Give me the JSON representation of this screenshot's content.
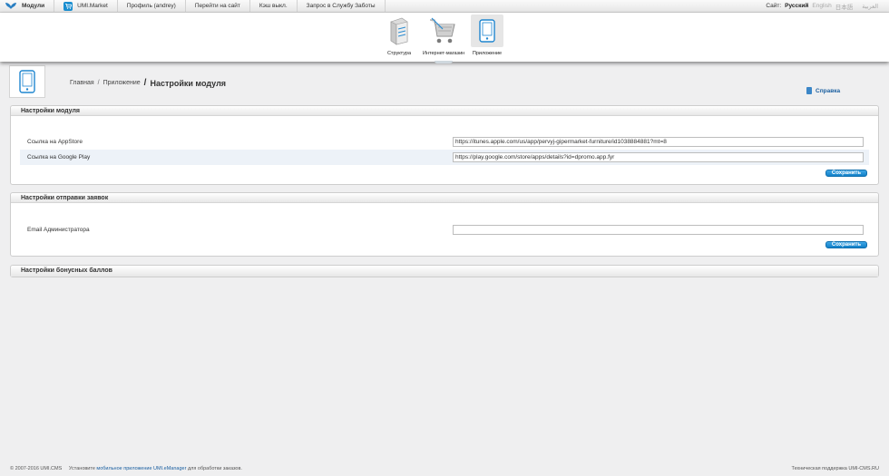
{
  "topbar": {
    "items": [
      "Модули",
      "UMI.Market",
      "Профиль (andrey)",
      "Перейти на сайт",
      "Кэш выкл.",
      "Запрос в Службу Заботы"
    ],
    "site_label": "Сайт:",
    "lang_active": "Русский",
    "lang_other": [
      "English",
      "日本語",
      "العربية"
    ]
  },
  "modules": [
    {
      "label": "Структура"
    },
    {
      "label": "Интернет-магазин"
    },
    {
      "label": "Приложение"
    }
  ],
  "breadcrumb": {
    "home": "Главная",
    "sep": "/",
    "parent": "Приложение",
    "current": "Настройки модуля"
  },
  "help_label": "Справка",
  "panels": {
    "module_settings": {
      "title": "Настройки модуля",
      "rows": [
        {
          "label": "Ссылка на AppStore",
          "value": "https://itunes.apple.com/us/app/pervyj-gipermarket-furniture/id1038884881?mt=8"
        },
        {
          "label": "Ссылка на Google Play",
          "value": "https://play.google.com/store/apps/details?id=dpromo.app.fyr"
        }
      ],
      "save_label": "Сохранить"
    },
    "orders_settings": {
      "title": "Настройки отправки заявок",
      "rows": [
        {
          "label": "Email Администратора",
          "value": ""
        }
      ],
      "save_label": "Сохранить"
    },
    "bonus_settings": {
      "title": "Настройки бонусных баллов"
    }
  },
  "footer": {
    "copyright": "© 2007-2016 UMI.CMS",
    "install_text": "Установите",
    "link_text": "мобильное приложение UMI.eManager",
    "after_text": "для обработки заказов.",
    "support": "Техническая поддержка UMI-CMS.RU"
  },
  "colors": {
    "accent": "#1a8ed0",
    "link": "#1a5fa0",
    "row_shade": "#edf2f8"
  }
}
